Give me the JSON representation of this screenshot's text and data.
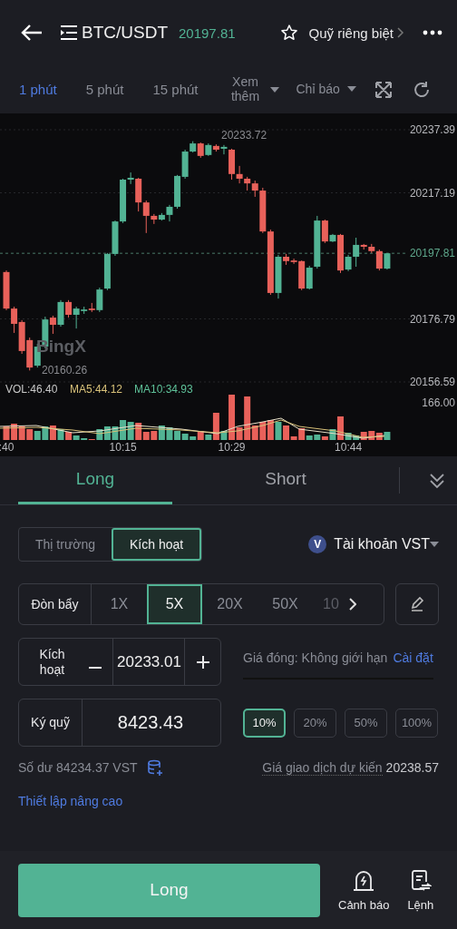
{
  "header": {
    "symbol": "BTC/USDT",
    "price": "20197.81",
    "margin_mode": "Quỹ riêng biệt"
  },
  "timeframes": [
    {
      "label": "1 phút",
      "selected": true
    },
    {
      "label": "5 phút",
      "selected": false
    },
    {
      "label": "15 phút",
      "selected": false
    }
  ],
  "more": "Xem thêm",
  "indicators_menu": "Chỉ báo",
  "chart": {
    "chart_data": {
      "type": "candlestick",
      "grid": true,
      "ref_lines": [
        {
          "axis": "y",
          "value": 20197.81,
          "label": "20197.81"
        }
      ],
      "ylim": [
        20156.59,
        20237.39
      ],
      "ohlc": [
        [
          20191.8,
          20192.3,
          20179.6,
          20180.1
        ],
        [
          20180.1,
          20180.7,
          20172.3,
          20175.2
        ],
        [
          20175.8,
          20176.4,
          20165.6,
          20166.5
        ],
        [
          20170.0,
          20170.8,
          20160.26,
          20161.2
        ],
        [
          20161.8,
          20168.8,
          20161.2,
          20167.9
        ],
        [
          20167.9,
          20177.5,
          20167.3,
          20176.6
        ],
        [
          20177.2,
          20177.8,
          20172.0,
          20174.9
        ],
        [
          20174.9,
          20182.8,
          20174.3,
          20182.2
        ],
        [
          20182.2,
          20182.8,
          20177.2,
          20178.1
        ],
        [
          20178.1,
          20180.7,
          20173.7,
          20180.1
        ],
        [
          20179.3,
          20180.7,
          20178.4,
          20179.8
        ],
        [
          20180.1,
          20181.9,
          20179.0,
          20179.6
        ],
        [
          20179.6,
          20186.8,
          20179.0,
          20186.2
        ],
        [
          20186.5,
          20197.9,
          20186.0,
          20197.6
        ],
        [
          20197.6,
          20208.3,
          20197.0,
          20208.0
        ],
        [
          20208.0,
          20221.7,
          20207.5,
          20221.4
        ],
        [
          20221.4,
          20223.7,
          20220.0,
          20222.0
        ],
        [
          20221.7,
          20222.0,
          20211.2,
          20214.1
        ],
        [
          20214.1,
          20214.7,
          20204.3,
          20209.8
        ],
        [
          20209.8,
          20210.4,
          20207.2,
          20208.6
        ],
        [
          20208.6,
          20210.7,
          20208.3,
          20210.1
        ],
        [
          20210.1,
          20213.3,
          20208.0,
          20212.7
        ],
        [
          20212.7,
          20222.9,
          20212.1,
          20222.6
        ],
        [
          20222.3,
          20231.0,
          20221.7,
          20230.4
        ],
        [
          20230.4,
          20233.72,
          20230.1,
          20233.0
        ],
        [
          20233.0,
          20233.3,
          20228.4,
          20229.0
        ],
        [
          20229.3,
          20233.0,
          20229.0,
          20232.5
        ],
        [
          20232.2,
          20232.7,
          20230.4,
          20231.0
        ],
        [
          20231.3,
          20232.5,
          20229.5,
          20231.9
        ],
        [
          20231.0,
          20231.3,
          20221.4,
          20223.2
        ],
        [
          20223.2,
          20225.8,
          20220.2,
          20221.7
        ],
        [
          20221.7,
          20222.3,
          20217.9,
          20220.2
        ],
        [
          20220.2,
          20221.1,
          20215.9,
          20217.9
        ],
        [
          20217.9,
          20218.8,
          20204.3,
          20204.8
        ],
        [
          20204.8,
          20205.4,
          20184.5,
          20185.1
        ],
        [
          20185.1,
          20197.3,
          20183.3,
          20196.7
        ],
        [
          20196.7,
          20197.6,
          20194.1,
          20195.3
        ],
        [
          20195.5,
          20196.1,
          20194.4,
          20195.0
        ],
        [
          20195.3,
          20195.5,
          20186.0,
          20186.5
        ],
        [
          20186.5,
          20193.8,
          20186.2,
          20193.2
        ],
        [
          20193.5,
          20209.8,
          20192.9,
          20208.3
        ],
        [
          20208.3,
          20208.6,
          20201.1,
          20201.6
        ],
        [
          20201.6,
          20204.0,
          20201.4,
          20203.7
        ],
        [
          20203.7,
          20204.0,
          20191.5,
          20192.3
        ],
        [
          20192.6,
          20197.3,
          20192.1,
          20196.7
        ],
        [
          20196.7,
          20202.8,
          20193.5,
          20200.5
        ],
        [
          20200.5,
          20200.8,
          20199.0,
          20199.9
        ],
        [
          20199.9,
          20200.8,
          20197.9,
          20198.5
        ],
        [
          20198.5,
          20199.0,
          20192.3,
          20192.9
        ],
        [
          20192.9,
          20197.9,
          20192.6,
          20197.81
        ]
      ],
      "yticks": [
        20156.59,
        20176.79,
        20217.19,
        20237.39
      ],
      "categories": [
        ":40",
        null,
        null,
        null,
        null,
        null,
        null,
        null,
        null,
        null,
        null,
        null,
        null,
        null,
        null,
        "10:15",
        null,
        null,
        null,
        null,
        null,
        null,
        null,
        null,
        null,
        null,
        null,
        null,
        null,
        "10:29",
        null,
        null,
        null,
        null,
        null,
        null,
        null,
        null,
        null,
        null,
        null,
        null,
        null,
        null,
        "10:44",
        null,
        null,
        null,
        null,
        null
      ]
    },
    "high_label": "20233.72",
    "low_label": "20160.26",
    "logo": "BingX",
    "legend": [
      {
        "label": "VOL:46.40",
        "color": "#c8c8c8"
      },
      {
        "label": "MA5:44.12",
        "color": "#d9c27a"
      },
      {
        "label": "MA10:34.93",
        "color": "#5fc29a"
      }
    ],
    "volume_max": "166.00"
  },
  "side_tabs": [
    {
      "label": "Long",
      "selected": true
    },
    {
      "label": "Short",
      "selected": false
    }
  ],
  "order_types": [
    {
      "label": "Thị trường",
      "selected": false
    },
    {
      "label": "Kích hoạt",
      "selected": true
    }
  ],
  "account": {
    "badge": "V",
    "label": "Tài khoản VST"
  },
  "leverage": {
    "label": "Đòn bẩy",
    "options": [
      {
        "label": "1X",
        "selected": false
      },
      {
        "label": "5X",
        "selected": true
      },
      {
        "label": "20X",
        "selected": false
      },
      {
        "label": "50X",
        "selected": false
      },
      {
        "label": "10",
        "selected": false
      }
    ]
  },
  "trigger": {
    "label": "Kích hoạt",
    "value": "20233.01"
  },
  "close_price": {
    "label": "Giá đóng: Không giới hạn",
    "link": "Cài đặt"
  },
  "margin": {
    "label": "Ký quỹ",
    "value": "8423.43"
  },
  "percents": [
    {
      "label": "10%",
      "selected": true
    },
    {
      "label": "20%",
      "selected": false
    },
    {
      "label": "50%",
      "selected": false
    },
    {
      "label": "100%",
      "selected": false
    }
  ],
  "balance": "Số dư 84234.37 VST",
  "estimate": {
    "label": "Giá giao dịch dự kiến",
    "value": "20238.57"
  },
  "advanced": "Thiết lập nâng cao",
  "submit": "Long",
  "actions": [
    {
      "label": "Cảnh báo",
      "kind": "alert"
    },
    {
      "label": "Lệnh",
      "kind": "orders"
    }
  ]
}
